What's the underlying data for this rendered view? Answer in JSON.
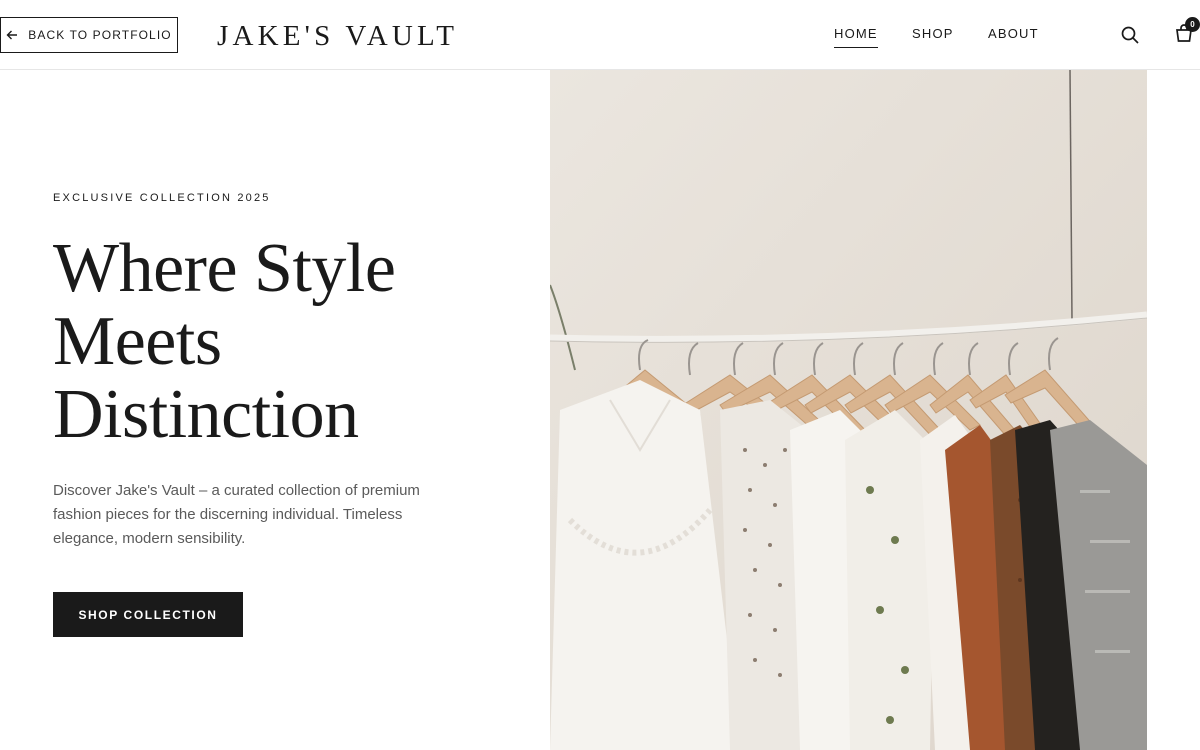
{
  "header": {
    "back_label": "BACK TO PORTFOLIO",
    "logo": "JAKE'S VAULT",
    "nav": [
      {
        "label": "HOME",
        "active": true
      },
      {
        "label": "SHOP",
        "active": false
      },
      {
        "label": "ABOUT",
        "active": false
      }
    ],
    "cart_count": "0",
    "icons": {
      "back": "arrow-left-icon",
      "search": "search-icon",
      "cart": "shopping-bag-icon"
    }
  },
  "hero": {
    "eyebrow": "EXCLUSIVE COLLECTION 2025",
    "headline_lines": [
      "Where Style",
      "Meets",
      "Distinction"
    ],
    "description": "Discover Jake's Vault – a curated collection of premium fashion pieces for the discerning individual. Timeless elegance, modern sensibility.",
    "cta_label": "SHOP COLLECTION",
    "image_alt": "clothes-rack-photo"
  },
  "colors": {
    "text": "#1a1a1a",
    "muted_text": "#5a5a5a",
    "button_bg": "#1a1a1a",
    "button_text": "#ffffff",
    "image_wall": "#e9e3dc"
  }
}
